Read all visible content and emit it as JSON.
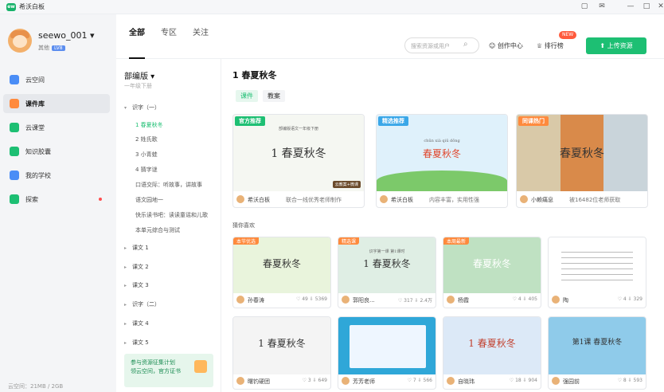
{
  "app": {
    "name": "希沃白板",
    "logo_text": "ew"
  },
  "window_controls": [
    "help-icon",
    "mail-icon",
    "minimize-icon",
    "maximize-icon",
    "close-icon"
  ],
  "user": {
    "name": "seewo_001",
    "role": "其他",
    "level": "LV8"
  },
  "sidebar": {
    "items": [
      {
        "label": "云空间",
        "icon": "cloud-icon",
        "color": "#4a8df6"
      },
      {
        "label": "课件库",
        "icon": "heart-icon",
        "color": "#ff8a3d",
        "active": true
      },
      {
        "label": "云课堂",
        "icon": "play-circle-icon",
        "color": "#1dbf73"
      },
      {
        "label": "知识胶囊",
        "icon": "capsule-icon",
        "color": "#1dbf73"
      },
      {
        "label": "我的学校",
        "icon": "school-icon",
        "color": "#4a8df6"
      },
      {
        "label": "探索",
        "icon": "rocket-icon",
        "color": "#1dbf73",
        "dot": true
      }
    ],
    "storage": "云空间：21MB / 2GB"
  },
  "topnav": {
    "tabs": [
      "全部",
      "专区",
      "关注"
    ],
    "active_tab": "全部"
  },
  "header": {
    "search_placeholder": "搜索资源或用户",
    "creator_center": "创作中心",
    "ranking": "排行榜",
    "new_badge": "NEW",
    "upload": "上传资源"
  },
  "tree": {
    "edition": "部编版",
    "grade": "一年级下册",
    "items": [
      {
        "label": "识字（一）",
        "type": "parent",
        "open": true
      },
      {
        "label": "1 春夏秋冬",
        "type": "child",
        "selected": true
      },
      {
        "label": "2 姓氏歌",
        "type": "child"
      },
      {
        "label": "3 小青蛙",
        "type": "child"
      },
      {
        "label": "4 猜字谜",
        "type": "child"
      },
      {
        "label": "口语交际：听故事，讲故事",
        "type": "child"
      },
      {
        "label": "语文园地一",
        "type": "child"
      },
      {
        "label": "快乐读书吧：读读童谣和儿歌",
        "type": "child"
      },
      {
        "label": "本单元综合与测试",
        "type": "child"
      },
      {
        "label": "课文 1",
        "type": "parent"
      },
      {
        "label": "课文 2",
        "type": "parent"
      },
      {
        "label": "课文 3",
        "type": "parent"
      },
      {
        "label": "识字（二）",
        "type": "parent"
      },
      {
        "label": "课文 4",
        "type": "parent"
      },
      {
        "label": "课文 5",
        "type": "parent"
      }
    ],
    "promo_line1": "参与资源征集计划",
    "promo_line2": "领云空间，官方证书"
  },
  "main": {
    "title": "1 春夏秋冬",
    "subtabs": [
      "课件",
      "教案"
    ],
    "featured": [
      {
        "ribbon": "官方推荐",
        "ribbon_color": "#1dbf73",
        "thumb_title": "1 春夏秋冬",
        "thumb_corner": "云教案+微课",
        "thumb_subtitle": "部编版语文一年级下册",
        "author": "希沃白板",
        "desc": "联合一线优秀老师制作"
      },
      {
        "ribbon": "精选推荐",
        "ribbon_color": "#3aa7e8",
        "thumb_title": "春夏秋冬",
        "thumb_subtitle": "chūn xià qiū dōng",
        "author": "希沃白板",
        "desc": "内容丰富，实用性强"
      },
      {
        "ribbon": "同课热门",
        "ribbon_color": "#ff8a3d",
        "thumb_title": "春夏秋冬",
        "author": "小赖痛息",
        "desc": "被16482位老师获取"
      }
    ],
    "recommend_label": "猜你喜欢",
    "cards": [
      {
        "tag": "本节优选",
        "tag_color": "#ff8a3d",
        "title": "春夏秋冬",
        "author": "孙春涛",
        "likes": "49",
        "downloads": "5369",
        "bg": "#e9f4dc"
      },
      {
        "tag": "精选课",
        "tag_color": "#ff8a3d",
        "title": "1 春夏秋冬",
        "subtitle": "识字第一课  第1课时",
        "author": "郭阳良...",
        "likes": "317",
        "downloads": "2.4万",
        "bg": "#dfeee4"
      },
      {
        "tag": "本周最新",
        "tag_color": "#ff8a3d",
        "title": "春夏秋冬",
        "author": "杨霞",
        "likes": "4",
        "downloads": "405",
        "bg": "#bfe1c2"
      },
      {
        "title": "",
        "author": "陶",
        "likes": "4",
        "downloads": "329",
        "bg": "#ffffff"
      },
      {
        "title": "1 春夏秋冬",
        "author": "曙钓硬团",
        "likes": "3",
        "downloads": "649",
        "bg": "#f4f4f4"
      },
      {
        "title": "",
        "author": "芳芳老师",
        "likes": "7",
        "downloads": "566",
        "bg": "#2fa7d8"
      },
      {
        "title": "1 春夏秋冬",
        "author": "自晓玮",
        "likes": "18",
        "downloads": "904",
        "bg": "#dce9f7"
      },
      {
        "title": "第1课  春夏秋冬",
        "author": "强园前",
        "likes": "8",
        "downloads": "593",
        "bg": "#8fcbea"
      }
    ]
  },
  "colors": {
    "accent": "#1dbf73",
    "sidebar_bg": "#f4f5f7"
  }
}
